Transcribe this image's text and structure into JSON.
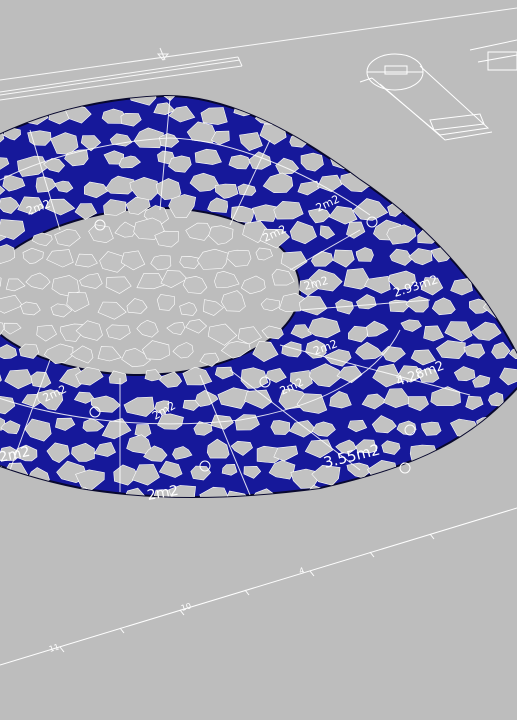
{
  "colors": {
    "background": "#bdbdbd",
    "panel": "#16189a",
    "panel_edge": "#08082e",
    "cut_hole": "#c2c2c2",
    "annotation": "#ffffff"
  },
  "area_labels": [
    "3.55m2",
    "4.28m2",
    "2.93m2",
    "2m2",
    "2m2",
    "2m2",
    "2m2",
    "2m2",
    "2m2",
    "2m2",
    "2m2",
    "2m2",
    "2m2"
  ],
  "ruler_ticks": [
    "10",
    "11",
    "4"
  ]
}
